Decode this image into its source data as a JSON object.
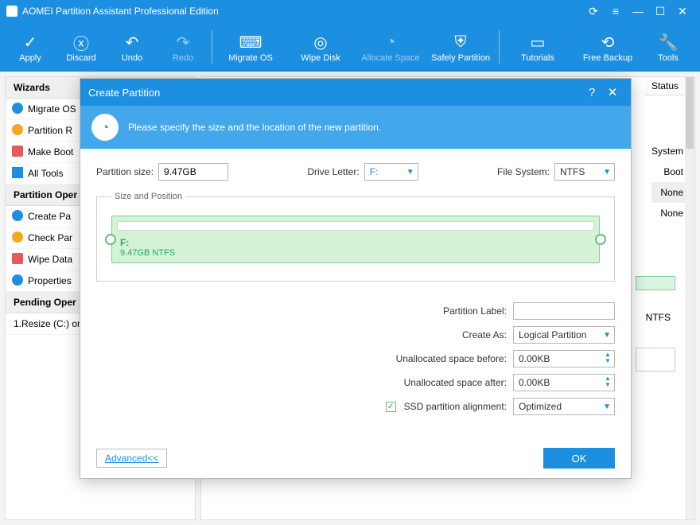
{
  "window": {
    "title": "AOMEI Partition Assistant Professional Edition"
  },
  "toolbar": [
    {
      "label": "Apply"
    },
    {
      "label": "Discard"
    },
    {
      "label": "Undo"
    },
    {
      "label": "Redo",
      "disabled": true
    },
    {
      "label": "Migrate OS"
    },
    {
      "label": "Wipe Disk"
    },
    {
      "label": "Allocate Space",
      "disabled": true
    },
    {
      "label": "Safely Partition"
    },
    {
      "label": "Tutorials"
    },
    {
      "label": "Free Backup"
    },
    {
      "label": "Tools"
    }
  ],
  "sidebar": {
    "wizards_head": "Wizards",
    "wizards": [
      {
        "label": "Migrate OS"
      },
      {
        "label": "Partition R"
      },
      {
        "label": "Make Boot"
      },
      {
        "label": "All Tools"
      }
    ],
    "ops_head": "Partition Oper",
    "ops": [
      {
        "label": "Create Pa"
      },
      {
        "label": "Check Par"
      },
      {
        "label": "Wipe Data"
      },
      {
        "label": "Properties"
      }
    ],
    "pending_head": "Pending Oper",
    "pending": [
      {
        "label": "1.Resize (C:) on"
      }
    ]
  },
  "right_panel": {
    "status_col": "Status",
    "rows": [
      "System",
      "Boot",
      "None",
      "None"
    ],
    "ntfs_cell": "NTFS"
  },
  "modal": {
    "title": "Create Partition",
    "banner": "Please specify the size and the location of the new partition.",
    "partition_size_label": "Partition size:",
    "partition_size_value": "9.47GB",
    "drive_letter_label": "Drive Letter:",
    "drive_letter_value": "F:",
    "file_system_label": "File System:",
    "file_system_value": "NTFS",
    "size_position_legend": "Size and Position",
    "track_drive": "F:",
    "track_desc": "9.47GB NTFS",
    "partition_label_label": "Partition Label:",
    "partition_label_value": "",
    "create_as_label": "Create As:",
    "create_as_value": "Logical Partition",
    "before_label": "Unallocated space before:",
    "before_value": "0.00KB",
    "after_label": "Unallocated space after:",
    "after_value": "0.00KB",
    "ssd_label": "SSD partition alignment:",
    "ssd_value": "Optimized",
    "advanced_btn": "Advanced<<",
    "ok_btn": "OK"
  }
}
